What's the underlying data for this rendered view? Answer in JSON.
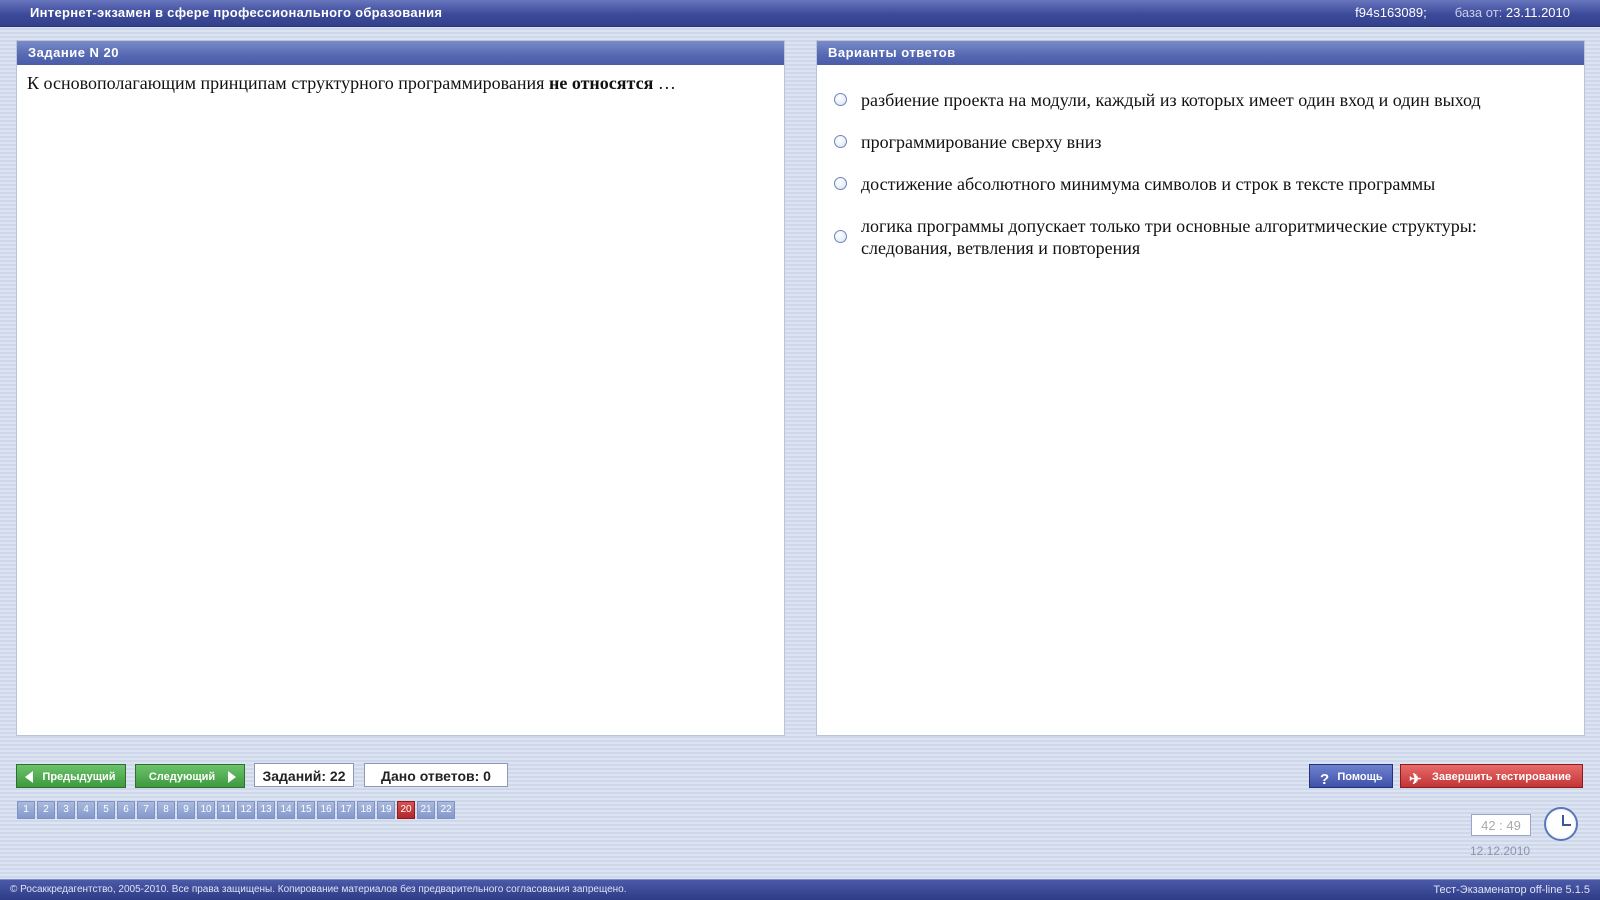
{
  "app": {
    "title": "Интернет-экзамен в сфере профессионального образования",
    "session_id": "f94s163089;",
    "db_label": "база от:",
    "db_date": "23.11.2010"
  },
  "task": {
    "header": "Задание N 20",
    "question_prefix": "К основополагающим принципам структурного программирования ",
    "question_bold": "не относятся",
    "question_suffix": " …"
  },
  "answers": {
    "header": "Варианты ответов",
    "options": [
      "разбиение проекта на модули, каждый из которых имеет один вход и один выход",
      "программирование сверху вниз",
      "достижение абсолютного минимума символов и строк в тексте программы",
      "логика программы допускает только три основные алгоритмические структуры: следования, ветвления и повторения"
    ]
  },
  "nav": {
    "prev": "Предыдущий",
    "next": "Следующий",
    "tasks_count": "Заданий: 22",
    "answered_count": "Дано ответов: 0",
    "help": "Помощь",
    "finish": "Завершить тестирование",
    "pages": [
      "1",
      "2",
      "3",
      "4",
      "5",
      "6",
      "7",
      "8",
      "9",
      "10",
      "11",
      "12",
      "13",
      "14",
      "15",
      "16",
      "17",
      "18",
      "19",
      "20",
      "21",
      "22"
    ],
    "current_page": "20"
  },
  "timer": {
    "time": "42 : 49",
    "date": "12.12.2010"
  },
  "footer": {
    "copyright": "© Росаккредагентство, 2005-2010. Все права защищены. Копирование материалов без предварительного согласования запрещено.",
    "version": "Тест-Экзаменатор off-line 5.1.5"
  },
  "colors": {
    "header_blue": "#3c4a9a",
    "nav_green": "#3d9a3d",
    "active_page_red": "#b32828",
    "finish_red": "#c33434"
  }
}
